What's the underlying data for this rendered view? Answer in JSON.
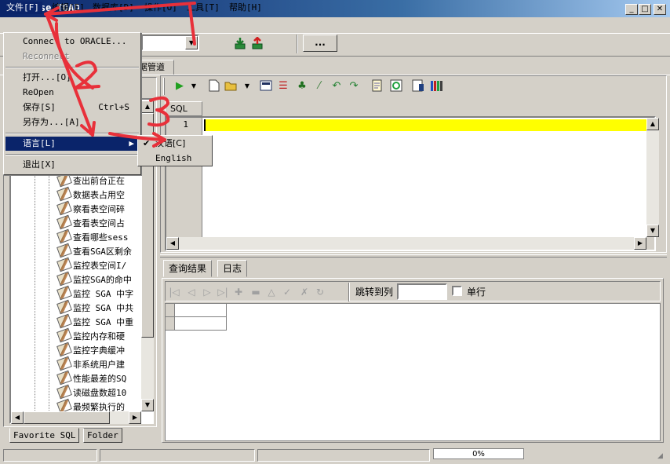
{
  "window": {
    "title": "Sybase TOAD",
    "caption_buttons": [
      "_",
      "□",
      "✕"
    ]
  },
  "menubar": [
    {
      "label": "文件[F]"
    },
    {
      "label": "编辑[E]"
    },
    {
      "label": "数据库[D]"
    },
    {
      "label": "操作[O]"
    },
    {
      "label": "工具[T]"
    },
    {
      "label": "帮助[H]"
    }
  ],
  "file_menu": {
    "items": [
      {
        "label": "Connect to ORACLE...",
        "shortcut": "",
        "enabled": true
      },
      {
        "label": "Reconnect",
        "shortcut": "",
        "enabled": false
      },
      {
        "label": "打开...[O]",
        "shortcut": "",
        "enabled": true
      },
      {
        "label": "ReOpen",
        "shortcut": "",
        "enabled": true
      },
      {
        "label": "保存[S]",
        "shortcut": "Ctrl+S",
        "enabled": true
      },
      {
        "label": "另存为...[A]",
        "shortcut": "",
        "enabled": true
      },
      {
        "label": "语言[L]",
        "shortcut": "",
        "enabled": true,
        "selected": true
      },
      {
        "label": "退出[X]",
        "shortcut": "",
        "enabled": true
      }
    ],
    "language_submenu": [
      {
        "label": "汉语[C]",
        "checked": true
      },
      {
        "label": "English",
        "checked": false
      }
    ]
  },
  "toolbar": {
    "ellipsis_label": "...",
    "pipeline_tab": "据管道"
  },
  "left_panel": {
    "tree_items": [
      "查出前台正在",
      "数据表占用空",
      "察看表空间碎",
      "查看表空间占",
      "查看哪些sess",
      "查看SGA区剩余",
      "监控表空间I/",
      "监控SGA的命中",
      "监控 SGA 中字",
      "监控 SGA 中共",
      "监控 SGA 中重",
      "监控内存和硬",
      "监控字典缓冲",
      "非系统用户建",
      "性能最差的SQ",
      "读磁盘数超10",
      "最频繁执行的"
    ],
    "tabs": [
      "Favorite SQL",
      "Folder"
    ]
  },
  "editor": {
    "tab_label": "SQL",
    "line_number": "1",
    "highlight_color": "#ffff00"
  },
  "results": {
    "tabs": [
      "查询结果",
      "日志"
    ],
    "goto_label": "跳转到列",
    "single_row_label": "单行"
  },
  "statusbar": {
    "progress_text": "0%"
  },
  "annotations": {
    "color": "#e8303a",
    "labels": [
      "1",
      "2",
      "3"
    ]
  }
}
